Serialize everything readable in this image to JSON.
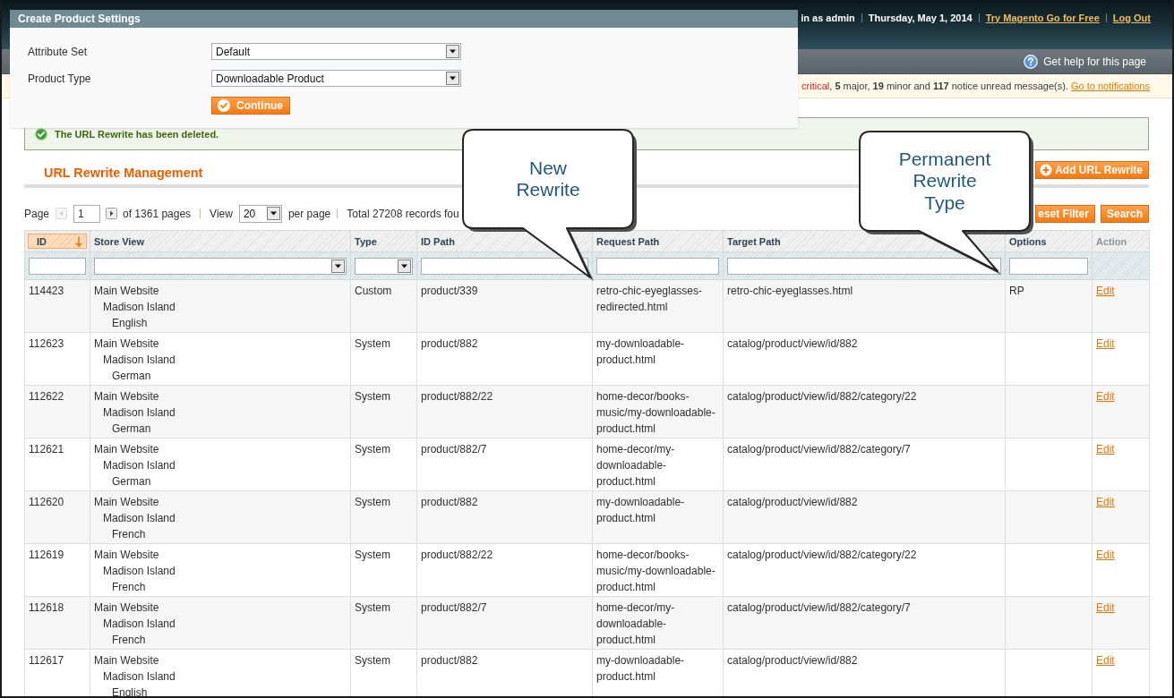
{
  "header": {
    "user_text": "in as admin",
    "date": "Thursday, May 1, 2014",
    "links": [
      "Try Magento Go for Free",
      "Log Out"
    ]
  },
  "nav": {
    "help_link": "Get help for this page"
  },
  "notice": {
    "severity": "critical",
    "message": ", **5** major, **19** minor and **117** notice unread message(s).",
    "link": "Go to notifications"
  },
  "dialog": {
    "title": "Create Product Settings",
    "fields": [
      {
        "label": "Attribute Set",
        "value": "Default"
      },
      {
        "label": "Product Type",
        "value": "Downloadable Product"
      }
    ],
    "button": "Continue"
  },
  "message": {
    "kind": "success",
    "text": "The URL Rewrite has been deleted."
  },
  "content_header": {
    "title": "URL Rewrite Management",
    "button": "Add URL Rewrite"
  },
  "pager": {
    "page_label": "Page",
    "previous": {
      "disabled": true
    },
    "page": "1",
    "next": {
      "disabled": false
    },
    "pages_text": "of 1361 pages",
    "view_label": "View",
    "per_page": "20",
    "per_page_label": "per page",
    "total": "Total 27208 records fou",
    "buttons": [
      "eset Filter",
      "Search"
    ]
  },
  "grid": {
    "columns": [
      {
        "label": "ID",
        "sortable": true,
        "sorted": true
      },
      {
        "label": "Store View",
        "sortable": true,
        "sorted": false
      },
      {
        "label": "Type",
        "sortable": true,
        "sorted": false
      },
      {
        "label": "ID Path",
        "sortable": true,
        "sorted": false
      },
      {
        "label": "Request Path",
        "sortable": true,
        "sorted": false
      },
      {
        "label": "Target Path",
        "sortable": true,
        "sorted": false
      },
      {
        "label": "Options",
        "sortable": true,
        "sorted": false
      },
      {
        "label": "Action",
        "sortable": false,
        "sorted": false
      }
    ],
    "filters": [
      {
        "kind": "text"
      },
      {
        "kind": "select"
      },
      {
        "kind": "select"
      },
      {
        "kind": "text"
      },
      {
        "kind": "text"
      },
      {
        "kind": "text"
      },
      {
        "kind": "text"
      }
    ],
    "rows": [
      {
        "id": "114423",
        "store_view": {
          "website": "Main Website",
          "store": "Madison Island",
          "view": "English"
        },
        "type": "Custom",
        "id_path": "product/339",
        "request_path": "retro-chic-eyeglasses-redirected.html",
        "target_path": "retro-chic-eyeglasses.html",
        "options": "RP",
        "action": "Edit"
      },
      {
        "id": "112623",
        "store_view": {
          "website": "Main Website",
          "store": "Madison Island",
          "view": "German"
        },
        "type": "System",
        "id_path": "product/882",
        "request_path": "my-downloadable-product.html",
        "target_path": "catalog/product/view/id/882",
        "action": "Edit"
      },
      {
        "id": "112622",
        "store_view": {
          "website": "Main Website",
          "store": "Madison Island",
          "view": "German"
        },
        "type": "System",
        "id_path": "product/882/22",
        "request_path": "home-decor/books-music/my-downloadable-product.html",
        "target_path": "catalog/product/view/id/882/category/22",
        "action": "Edit"
      },
      {
        "id": "112621",
        "store_view": {
          "website": "Main Website",
          "store": "Madison Island",
          "view": "German"
        },
        "type": "System",
        "id_path": "product/882/7",
        "request_path": "home-decor/my-downloadable-product.html",
        "target_path": "catalog/product/view/id/882/category/7",
        "action": "Edit"
      },
      {
        "id": "112620",
        "store_view": {
          "website": "Main Website",
          "store": "Madison Island",
          "view": "French"
        },
        "type": "System",
        "id_path": "product/882",
        "request_path": "my-downloadable-product.html",
        "target_path": "catalog/product/view/id/882",
        "action": "Edit"
      },
      {
        "id": "112619",
        "store_view": {
          "website": "Main Website",
          "store": "Madison Island",
          "view": "French"
        },
        "type": "System",
        "id_path": "product/882/22",
        "request_path": "home-decor/books-music/my-downloadable-product.html",
        "target_path": "catalog/product/view/id/882/category/22",
        "action": "Edit"
      },
      {
        "id": "112618",
        "store_view": {
          "website": "Main Website",
          "store": "Madison Island",
          "view": "French"
        },
        "type": "System",
        "id_path": "product/882/7",
        "request_path": "home-decor/my-downloadable-product.html",
        "target_path": "catalog/product/view/id/882/category/7",
        "action": "Edit"
      },
      {
        "id": "112617",
        "store_view": {
          "website": "Main Website",
          "store": "Madison Island",
          "view": "English"
        },
        "type": "System",
        "id_path": "product/882",
        "request_path": "my-downloadable-product.html",
        "target_path": "catalog/product/view/id/882",
        "action": "Edit"
      }
    ]
  },
  "callouts": [
    {
      "text": "New Rewrite"
    },
    {
      "text": "Permanent Rewrite Type"
    }
  ]
}
